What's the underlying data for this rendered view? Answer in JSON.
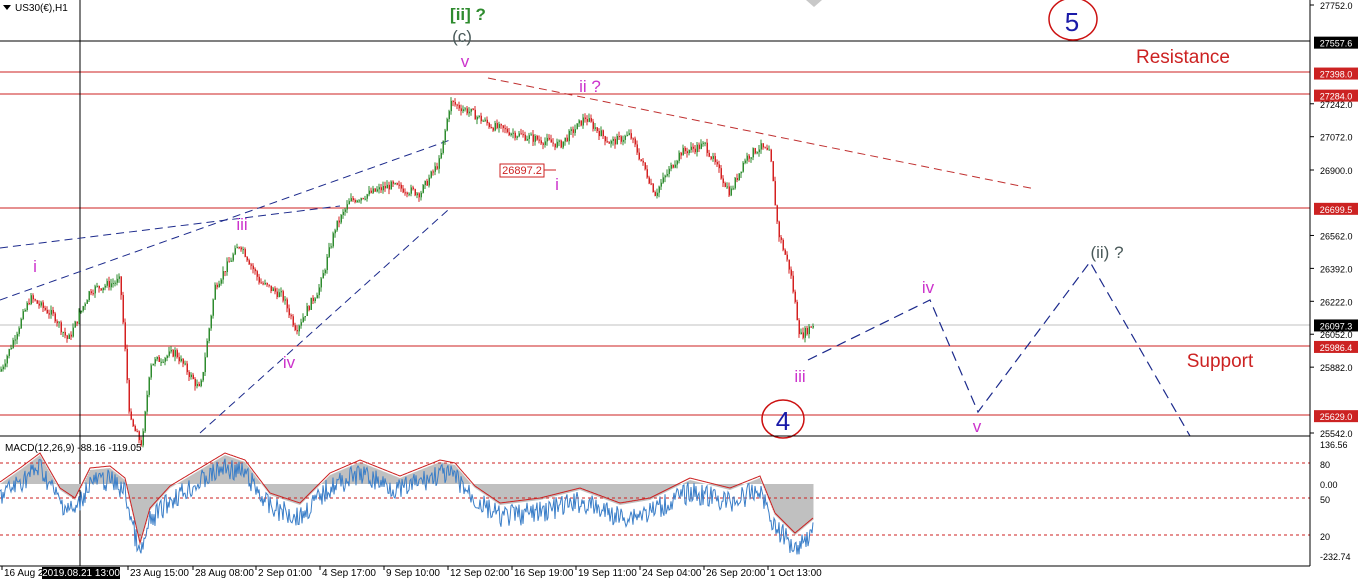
{
  "symbol": {
    "label": "US30(€),H1"
  },
  "chart_data": {
    "type": "candlestick",
    "instrument": "US30(€),H1",
    "price_axis_ticks": [
      "27752.0",
      "27242.0",
      "27072.0",
      "26900.0",
      "26562.0",
      "26392.0",
      "26222.0",
      "26052.0",
      "25882.0",
      "25542.0"
    ],
    "time_axis_labels": [
      "16 Aug 2",
      "23 Aug 15:00",
      "28 Aug 08:00",
      "2 Sep 01:00",
      "4 Sep 17:00",
      "9 Sep 10:00",
      "12 Sep 02:00",
      "16 Sep 19:00",
      "19 Sep 11:00",
      "24 Sep 04:00",
      "26 Sep 20:00",
      "1 Oct 13:00"
    ],
    "crosshair_time": "2019.08.21 13:00",
    "price_levels": [
      {
        "label": "27557.6",
        "dark": true
      },
      {
        "label": "27398.0",
        "dark": false
      },
      {
        "label": "27284.0",
        "dark": false
      },
      {
        "label": "26699.5",
        "dark": false
      },
      {
        "label": "26097.3",
        "dark": true,
        "current": true
      },
      {
        "label": "25986.4",
        "dark": false
      },
      {
        "label": "25629.0",
        "dark": false
      }
    ],
    "point_label": "26897.2",
    "text_labels": {
      "resistance": "Resistance",
      "support": "Support"
    },
    "wave_labels": [
      {
        "text": "[ii] ?",
        "color": "#2e8b2e"
      },
      {
        "text": "(c)",
        "color": "#4a5a5a"
      },
      {
        "text": "v",
        "color": "#cc33cc"
      },
      {
        "text": "ii ?",
        "color": "#cc33cc"
      },
      {
        "text": "i",
        "color": "#cc33cc"
      },
      {
        "text": "i",
        "color": "#cc33cc"
      },
      {
        "text": "iii",
        "color": "#cc33cc"
      },
      {
        "text": "iv",
        "color": "#cc33cc"
      },
      {
        "text": "iii",
        "color": "#cc33cc"
      },
      {
        "text": "iv",
        "color": "#cc33cc"
      },
      {
        "text": "v",
        "color": "#cc33cc"
      },
      {
        "text": "(ii) ?",
        "color": "#4a5a5a"
      },
      {
        "text": "5",
        "color": "#1a1aa8"
      },
      {
        "text": "4",
        "color": "#1a1aa8"
      }
    ],
    "macd": {
      "label": "MACD(12,26,9) -88.16 -119.05",
      "ticks": [
        "136.56",
        "80",
        "0.00",
        "50",
        "20",
        "-232.74"
      ]
    },
    "colors": {
      "bull": "#2e8b2e",
      "bear": "#d42020",
      "level_line": "#cc2222",
      "blue_dash": "#1c2a8c",
      "circle": "#cc1111",
      "macd_line": "#3a7ec8",
      "signal_line": "#cc2222",
      "histogram": "#c0c0c0"
    }
  }
}
